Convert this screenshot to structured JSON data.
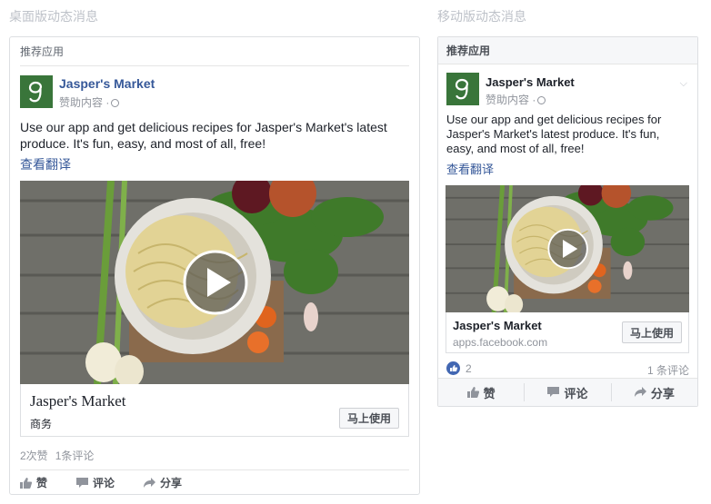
{
  "sections": {
    "desktop_title": "桌面版动态消息",
    "mobile_title": "移动版动态消息"
  },
  "card_header": {
    "desktop": "推荐应用",
    "mobile": "推荐应用"
  },
  "page": {
    "name": "Jasper's Market",
    "sponsored": "赞助内容 ·"
  },
  "post": {
    "text": "Use our app and get delicious recipes for Jasper's Market's latest produce. It's fun, easy, and most of all, free!",
    "translate": "查看翻译"
  },
  "desktop_footer": {
    "name": "Jasper's Market",
    "category": "商务",
    "cta": "马上使用"
  },
  "mobile_footer": {
    "name": "Jasper's Market",
    "url": "apps.facebook.com",
    "cta": "马上使用"
  },
  "desktop_stats": {
    "likes": "2次赞",
    "comments": "1条评论"
  },
  "mobile_stats": {
    "likes": "2",
    "comments": "1 条评论"
  },
  "actions": {
    "like": "赞",
    "comment": "评论",
    "share": "分享"
  },
  "icons": {
    "logo": "jaspers-market-logo",
    "globe": "globe-icon",
    "chevron": "chevron-down-icon",
    "play": "play-icon",
    "like": "thumbs-up-icon",
    "comment": "comment-icon",
    "share": "share-icon"
  },
  "colors": {
    "brand_green": "#39753a",
    "link_blue": "#365899",
    "like_blue": "#4267b2"
  }
}
